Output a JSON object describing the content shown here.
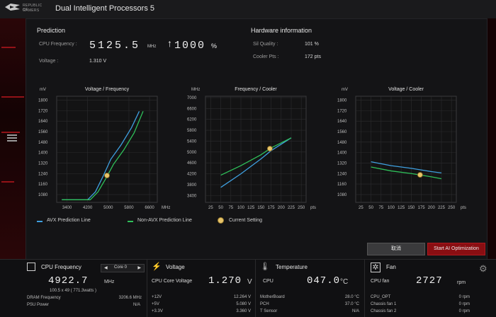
{
  "app": {
    "brand_top": "REPUBLIC OF",
    "brand_bottom": "GAMERS",
    "title": "Dual Intelligent Processors 5"
  },
  "prediction": {
    "title": "Prediction",
    "cpu_freq_label": "CPU Frequency :",
    "cpu_freq_value": "5125.5",
    "cpu_freq_unit": "MHz",
    "percent_value": "1000",
    "percent_sign": "%",
    "voltage_label": "Voltage :",
    "voltage_value": "1.310 V"
  },
  "hardware": {
    "title": "Hardware information",
    "sil_quality_label": "Sil Quality :",
    "sil_quality_value": "101 %",
    "cooler_pts_label": "Cooler Pts :",
    "cooler_pts_value": "172 pts"
  },
  "chart_data": [
    {
      "type": "line",
      "title": "Voltage / Frequency",
      "ylabel": "mV",
      "xlabel": "MHz",
      "x_ticks": [
        3400,
        4200,
        5000,
        5800,
        6600
      ],
      "y_ticks": [
        1080,
        1160,
        1240,
        1320,
        1400,
        1480,
        1560,
        1640,
        1720,
        1800
      ],
      "xlim": [
        3000,
        6900
      ],
      "ylim": [
        1020,
        1830
      ],
      "series": [
        {
          "name": "AVX Prediction Line",
          "color": "#3fa0e0",
          "x": [
            3200,
            4200,
            4500,
            4800,
            5100,
            5500,
            5900,
            6200
          ],
          "y": [
            1040,
            1040,
            1100,
            1220,
            1350,
            1460,
            1590,
            1715
          ]
        },
        {
          "name": "Non-AVX Prediction Line",
          "color": "#2fc05a",
          "x": [
            3200,
            4300,
            4600,
            4900,
            5200,
            5600,
            6000,
            6350
          ],
          "y": [
            1040,
            1040,
            1100,
            1200,
            1310,
            1420,
            1550,
            1715
          ]
        }
      ],
      "current_setting": {
        "x": 4950,
        "y": 1225
      }
    },
    {
      "type": "line",
      "title": "Frequency / Cooler",
      "ylabel": "MHz",
      "xlabel": "pts",
      "x_ticks": [
        25,
        50,
        75,
        100,
        125,
        150,
        175,
        200,
        225,
        250
      ],
      "y_ticks": [
        3400,
        3800,
        4200,
        4600,
        5000,
        5400,
        5800,
        6200,
        6600,
        7000
      ],
      "xlim": [
        12,
        262
      ],
      "ylim": [
        3150,
        7050
      ],
      "series": [
        {
          "name": "AVX Prediction Line",
          "color": "#3fa0e0",
          "x": [
            50,
            100,
            150,
            175,
            225
          ],
          "y": [
            3700,
            4200,
            4750,
            5050,
            5520
          ]
        },
        {
          "name": "Non-AVX Prediction Line",
          "color": "#2fc05a",
          "x": [
            50,
            100,
            150,
            175,
            225
          ],
          "y": [
            4150,
            4500,
            4900,
            5150,
            5520
          ]
        }
      ],
      "current_setting": {
        "x": 172,
        "y": 5125
      }
    },
    {
      "type": "line",
      "title": "Voltage / Cooler",
      "ylabel": "mV",
      "xlabel": "pts",
      "x_ticks": [
        25,
        50,
        75,
        100,
        125,
        150,
        175,
        200,
        225,
        250
      ],
      "y_ticks": [
        1080,
        1160,
        1240,
        1320,
        1400,
        1480,
        1560,
        1640,
        1720,
        1800
      ],
      "xlim": [
        12,
        262
      ],
      "ylim": [
        1020,
        1830
      ],
      "series": [
        {
          "name": "AVX Prediction Line",
          "color": "#3fa0e0",
          "x": [
            50,
            100,
            150,
            200,
            225
          ],
          "y": [
            1330,
            1300,
            1280,
            1255,
            1245
          ]
        },
        {
          "name": "Non-AVX Prediction Line",
          "color": "#2fc05a",
          "x": [
            50,
            100,
            150,
            200,
            225
          ],
          "y": [
            1290,
            1260,
            1240,
            1215,
            1200
          ]
        }
      ],
      "current_setting": {
        "x": 172,
        "y": 1230
      }
    }
  ],
  "legend": {
    "avx": "AVX Prediction Line",
    "nonavx": "Non-AVX Prediction Line",
    "current": "Current Setting"
  },
  "buttons": {
    "cancel": "取消",
    "start": "Start AI Optimization"
  },
  "cpu_panel": {
    "title": "CPU Frequency",
    "core_select": "Core 0",
    "freq_value": "4922.7",
    "freq_unit": "MHz",
    "sub_line": "100.5  x  49    ( 771.3watts )",
    "dram_label": "DRAM Frequency",
    "dram_value": "3206.6  MHz",
    "psu_label": "PSU Power",
    "psu_value": "N/A"
  },
  "voltage_panel": {
    "title": "Voltage",
    "core_label": "CPU Core Voltage",
    "core_value": "1.270",
    "core_unit": "V",
    "rows": [
      {
        "label": "+12V",
        "value": "12.264  V"
      },
      {
        "label": "+5V",
        "value": "5.080  V"
      },
      {
        "label": "+3.3V",
        "value": "3.360  V"
      }
    ]
  },
  "temp_panel": {
    "title": "Temperature",
    "cpu_label": "CPU",
    "cpu_value": "047.0",
    "cpu_unit": "°C",
    "rows": [
      {
        "label": "MotherBoard",
        "value": "28.0 °C"
      },
      {
        "label": "PCH",
        "value": "37.0 °C"
      },
      {
        "label": "T Sensor",
        "value": "N/A"
      }
    ]
  },
  "fan_panel": {
    "title": "Fan",
    "cpu_label": "CPU fan",
    "cpu_value": "2727",
    "cpu_unit": "rpm",
    "rows": [
      {
        "label": "CPU_OPT",
        "value": "0  rpm"
      },
      {
        "label": "Chassis fan 1",
        "value": "0  rpm"
      },
      {
        "label": "Chassis fan 2",
        "value": "0  rpm"
      }
    ]
  },
  "colors": {
    "accent_red": "#8a0e12",
    "avx": "#3fa0e0",
    "nonavx": "#2fc05a",
    "current": "#e8c46a"
  }
}
